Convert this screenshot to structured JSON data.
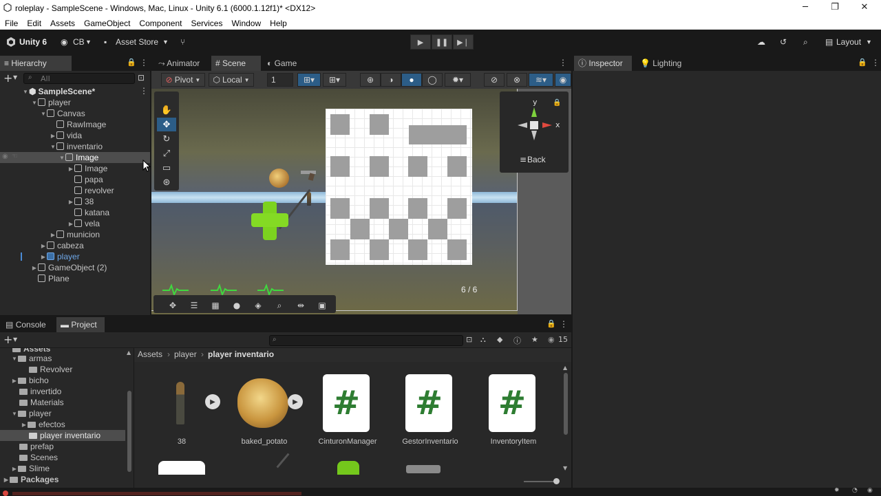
{
  "window": {
    "title": "roleplay - SampleScene - Windows, Mac, Linux - Unity 6.1 (6000.1.12f1)* <DX12>"
  },
  "menu": [
    "File",
    "Edit",
    "Assets",
    "GameObject",
    "Component",
    "Services",
    "Window",
    "Help"
  ],
  "toolbar": {
    "unity_label": "Unity 6",
    "account_label": "CB",
    "asset_store_label": "Asset Store",
    "layout_label": "Layout"
  },
  "hierarchy": {
    "tab_label": "Hierarchy",
    "search_placeholder": "All",
    "rows": [
      {
        "label": "SampleScene*"
      },
      {
        "label": "player"
      },
      {
        "label": "Canvas"
      },
      {
        "label": "RawImage"
      },
      {
        "label": "vida"
      },
      {
        "label": "inventario"
      },
      {
        "label": "Image"
      },
      {
        "label": "Image"
      },
      {
        "label": "papa"
      },
      {
        "label": "revolver"
      },
      {
        "label": "38"
      },
      {
        "label": "katana"
      },
      {
        "label": "vela"
      },
      {
        "label": "municion"
      },
      {
        "label": "cabeza"
      },
      {
        "label": "player"
      },
      {
        "label": "GameObject (2)"
      },
      {
        "label": "Plane"
      }
    ]
  },
  "scene_tabs": [
    {
      "label": "Animator"
    },
    {
      "label": "Scene"
    },
    {
      "label": "Game"
    }
  ],
  "scene_toolbar": {
    "pivot": "Pivot",
    "local": "Local",
    "grid_value": "1"
  },
  "gizmo": {
    "y": "y",
    "x": "x",
    "back": "Back"
  },
  "scene": {
    "page_indicator": "6 / 6"
  },
  "inspector_tabs": [
    {
      "label": "Inspector"
    },
    {
      "label": "Lighting"
    }
  ],
  "bottom_tabs": [
    {
      "label": "Console"
    },
    {
      "label": "Project"
    }
  ],
  "project": {
    "breadcrumb": [
      "Assets",
      "player",
      "player inventario"
    ],
    "hidden_count": "15",
    "tree": [
      {
        "label": "Assets"
      },
      {
        "label": "armas"
      },
      {
        "label": "Revolver"
      },
      {
        "label": "bicho"
      },
      {
        "label": "invertido"
      },
      {
        "label": "Materials"
      },
      {
        "label": "player"
      },
      {
        "label": "efectos"
      },
      {
        "label": "player inventario"
      },
      {
        "label": "prefap"
      },
      {
        "label": "Scenes"
      },
      {
        "label": "Slime"
      },
      {
        "label": "Packages"
      }
    ],
    "assets": [
      {
        "label": "38"
      },
      {
        "label": "baked_potato"
      },
      {
        "label": "CinturonManager"
      },
      {
        "label": "GestorInventario"
      },
      {
        "label": "InventoryItem"
      }
    ]
  },
  "colors": {
    "accent": "#4a8bd6",
    "selected": "#2c5d87",
    "background": "#282828",
    "scene_sky": "#6a6a45"
  }
}
